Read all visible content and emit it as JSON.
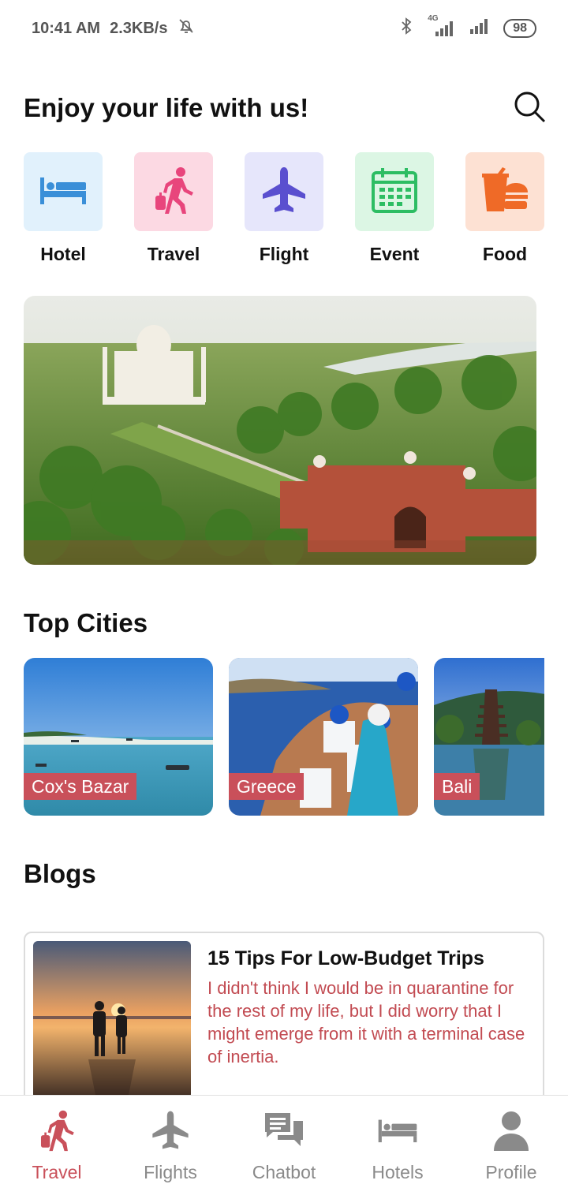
{
  "status_bar": {
    "time": "10:41 AM",
    "speed": "2.3KB/s",
    "network_label": "4G",
    "battery": "98"
  },
  "header": {
    "title": "Enjoy your life with us!",
    "search_icon": "search-icon"
  },
  "categories": [
    {
      "label": "Hotel",
      "icon": "bed-icon",
      "bg": "#e1f1fc",
      "color": "#3a8fd8"
    },
    {
      "label": "Travel",
      "icon": "traveler-icon",
      "bg": "#fcd9e3",
      "color": "#e8457c"
    },
    {
      "label": "Flight",
      "icon": "airplane-icon",
      "bg": "#e6e6fb",
      "color": "#5a4fcf"
    },
    {
      "label": "Event",
      "icon": "calendar-icon",
      "bg": "#dcf6e4",
      "color": "#2dbd63"
    },
    {
      "label": "Food",
      "icon": "fastfood-icon",
      "bg": "#fde1d3",
      "color": "#ef6a27"
    }
  ],
  "sections": {
    "top_cities": "Top Cities",
    "blogs": "Blogs"
  },
  "cities": [
    {
      "name": "Cox's Bazar"
    },
    {
      "name": "Greece"
    },
    {
      "name": "Bali"
    }
  ],
  "blog": {
    "title": "15 Tips For Low-Budget Trips",
    "excerpt": "I didn't think I would be in quarantine for the rest of my life, but I did worry that I might emerge from it with a terminal case of inertia."
  },
  "nav": [
    {
      "label": "Travel",
      "icon": "traveler-icon",
      "active": true
    },
    {
      "label": "Flights",
      "icon": "airplane-icon",
      "active": false
    },
    {
      "label": "Chatbot",
      "icon": "chat-icon",
      "active": false
    },
    {
      "label": "Hotels",
      "icon": "bed-icon",
      "active": false
    },
    {
      "label": "Profile",
      "icon": "person-icon",
      "active": false
    }
  ],
  "colors": {
    "accent": "#c9505a",
    "nav_inactive": "#8a8a8a"
  }
}
